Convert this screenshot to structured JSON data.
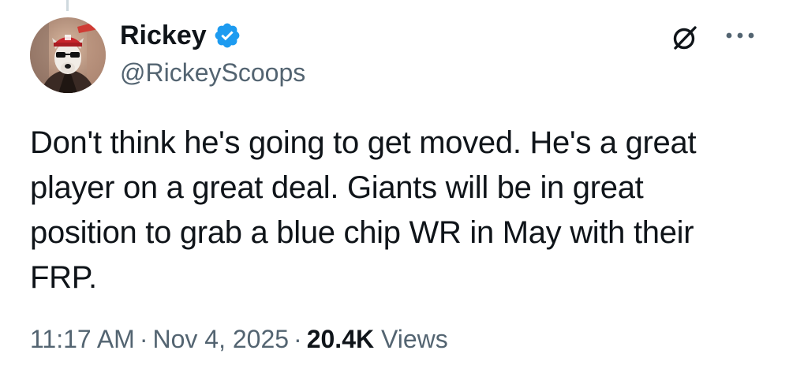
{
  "author": {
    "display_name": "Rickey",
    "handle": "@RickeyScoops",
    "verified": true,
    "avatar_icon": "dog-in-cap-avatar",
    "verified_color": "#1d9bf0"
  },
  "actions": {
    "grok_icon": "grok-icon",
    "more_icon": "more-dots-icon"
  },
  "tweet": {
    "text": "Don't think he's going to get moved. He's a great\nplayer on a great deal. Giants will be in great\nposition to grab a blue chip WR in May with their\nFRP."
  },
  "meta": {
    "time": "11:17 AM",
    "separator": "·",
    "date": "Nov 4, 2025",
    "views_count": "20.4K",
    "views_label": "Views"
  },
  "colors": {
    "text": "#0f1419",
    "secondary": "#536471",
    "accent": "#1d9bf0"
  }
}
